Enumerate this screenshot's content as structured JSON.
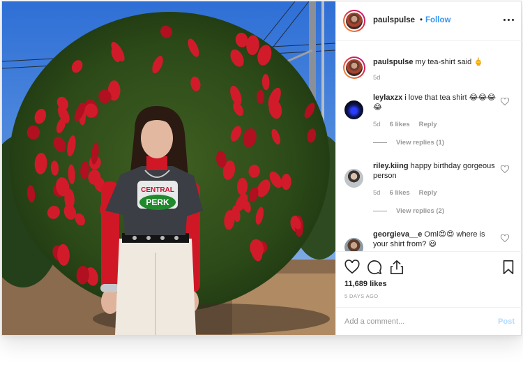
{
  "post": {
    "username": "paulspulse",
    "separator": "•",
    "follow_label": "Follow",
    "likes": "11,689 likes",
    "time_ago": "5 DAYS AGO",
    "add_comment_placeholder": "Add a comment...",
    "post_label": "Post",
    "photo_shirt_line1": "CENTRAL",
    "photo_shirt_line2": "PERK"
  },
  "comments": [
    {
      "username": "paulspulse",
      "text": "my tea-shirt said 🖕",
      "age": "5d",
      "likes": "",
      "reply": ""
    },
    {
      "username": "leylaxzx",
      "text": "i love that tea shirt 😂😂😂😂",
      "age": "5d",
      "likes": "6 likes",
      "reply": "Reply",
      "view_replies": "View replies (1)"
    },
    {
      "username": "riley.kiing",
      "text": "happy birthday gorgeous person",
      "age": "5d",
      "likes": "6 likes",
      "reply": "Reply",
      "view_replies": "View replies (2)"
    },
    {
      "username": "georgieva__e",
      "text": "Oml😍😍 where is your shirt from? 😃",
      "age": "",
      "likes": "",
      "reply": ""
    }
  ],
  "colors": {
    "accent": "#3897f0",
    "muted": "#999999",
    "post_disabled": "#b3dbff"
  },
  "icons": [
    "more-options-icon",
    "heart-icon",
    "comment-icon",
    "share-icon",
    "bookmark-icon"
  ]
}
